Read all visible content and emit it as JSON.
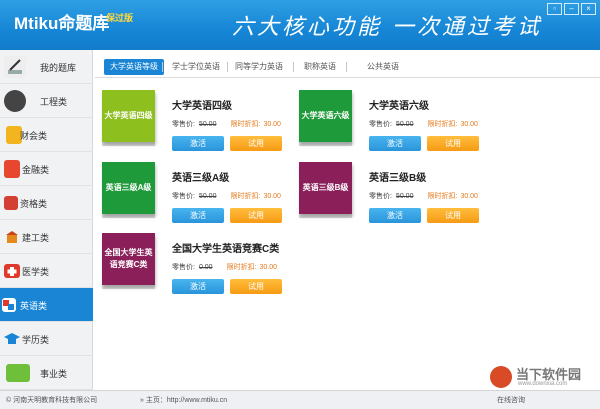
{
  "header": {
    "logo_text": "Mtiku命题库",
    "logo_badge": "保过版",
    "slogan": "六大核心功能 一次通过考试",
    "window_controls": [
      "▫",
      "–",
      "×"
    ]
  },
  "sidebar": {
    "items": [
      {
        "label": "我的题库",
        "icon": "pencil-icon"
      },
      {
        "label": "工程类",
        "icon": "engineering-icon"
      },
      {
        "label": "财会类",
        "icon": "finance-icon"
      },
      {
        "label": "金融类",
        "icon": "money-icon"
      },
      {
        "label": "资格类",
        "icon": "qualification-icon"
      },
      {
        "label": "建工类",
        "icon": "construction-icon"
      },
      {
        "label": "医学类",
        "icon": "medical-icon"
      },
      {
        "label": "英语类",
        "icon": "english-icon"
      },
      {
        "label": "学历类",
        "icon": "graduation-icon"
      },
      {
        "label": "事业类",
        "icon": "career-icon"
      }
    ],
    "active_index": 7
  },
  "tabs": {
    "items": [
      "大学英语等级",
      "学士学位英语",
      "同等学力英语",
      "职称英语",
      "公共英语"
    ],
    "active_index": 0
  },
  "products": [
    {
      "book": "大学英语四级",
      "title": "大学英语四级",
      "retail_label": "零售价:",
      "retail_price": "50.00",
      "discount_label": "限时折扣:",
      "discount_price": "30.00",
      "activate": "激活",
      "trial": "试用",
      "color": "#8dbf1e"
    },
    {
      "book": "大学英语六级",
      "title": "大学英语六级",
      "retail_label": "零售价:",
      "retail_price": "50.00",
      "discount_label": "限时折扣:",
      "discount_price": "30.00",
      "activate": "激活",
      "trial": "试用",
      "color": "#1f9a3a"
    },
    {
      "book": "英语三级A级",
      "title": "英语三级A级",
      "retail_label": "零售价:",
      "retail_price": "50.00",
      "discount_label": "限时折扣:",
      "discount_price": "30.00",
      "activate": "激活",
      "trial": "试用",
      "color": "#1f9a3a"
    },
    {
      "book": "英语三级B级",
      "title": "英语三级B级",
      "retail_label": "零售价:",
      "retail_price": "50.00",
      "discount_label": "限时折扣:",
      "discount_price": "30.00",
      "activate": "激活",
      "trial": "试用",
      "color": "#8a1f5a"
    },
    {
      "book": "全国大学生英语竞赛C类",
      "title": "全国大学生英语竞赛C类",
      "retail_label": "零售价:",
      "retail_price": "0.00",
      "discount_label": "限时折扣:",
      "discount_price": "30.00",
      "activate": "激活",
      "trial": "试用",
      "color": "#8a1f5a"
    }
  ],
  "statusbar": {
    "copyright": "© 河南天明教育科技有限公司",
    "home": "» 主页：http://www.mtiku.cn",
    "service": "在线咨询"
  },
  "watermark": {
    "title": "当下软件园",
    "subtitle": "www.downxia.com"
  }
}
